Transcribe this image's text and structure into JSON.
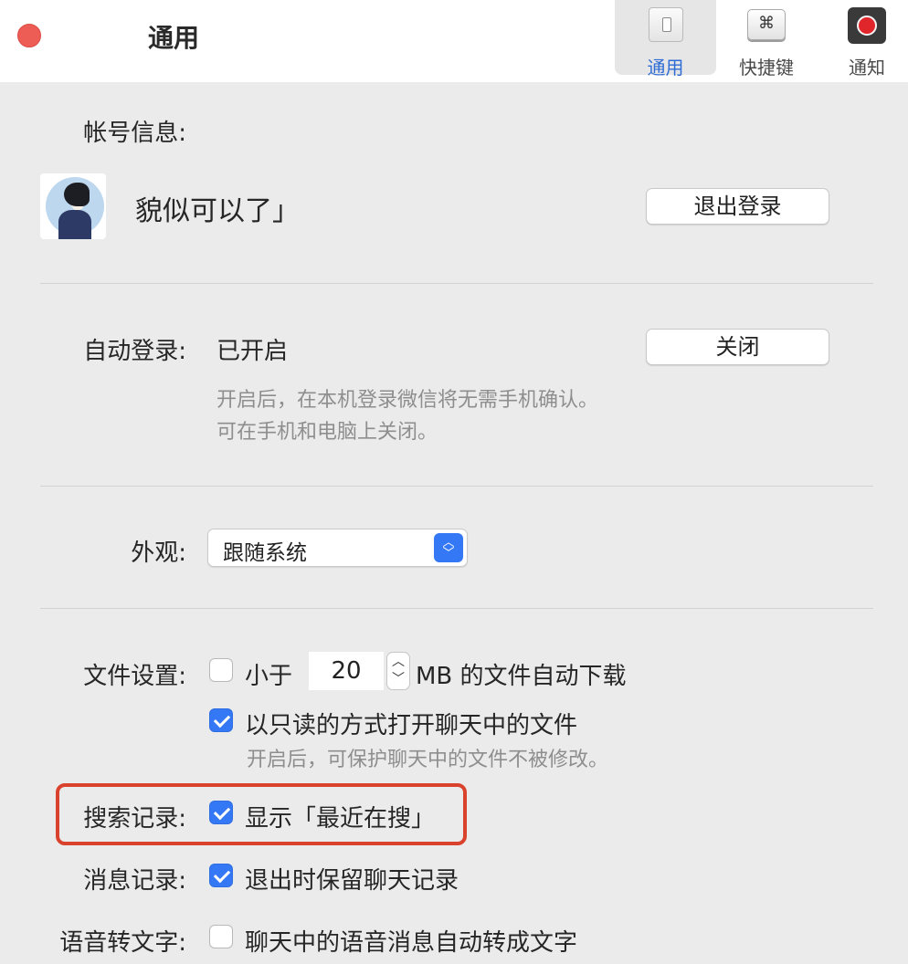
{
  "window": {
    "title": "通用",
    "tabs": [
      {
        "label": "通用",
        "icon": "switch-icon",
        "selected": true
      },
      {
        "label": "快捷键",
        "icon": "⌘"
      },
      {
        "label": "通知",
        "icon": "record-icon"
      }
    ]
  },
  "account": {
    "label": "帐号信息:",
    "nickname": "貌似可以了」",
    "logout_button": "退出登录"
  },
  "auto_login": {
    "label": "自动登录:",
    "status": "已开启",
    "button": "关闭",
    "hint_line1": "开启后，在本机登录微信将无需手机确认。",
    "hint_line2": "可在手机和电脑上关闭。"
  },
  "appearance": {
    "label": "外观:",
    "selected": "跟随系统"
  },
  "file_settings": {
    "label": "文件设置:",
    "auto_download": {
      "checked": false,
      "prefix": "小于",
      "size_value": "20",
      "suffix": "MB 的文件自动下载"
    },
    "read_only": {
      "checked": true,
      "text": "以只读的方式打开聊天中的文件",
      "hint": "开启后，可保护聊天中的文件不被修改。"
    }
  },
  "search_history": {
    "label": "搜索记录:",
    "checked": true,
    "text": "显示「最近在搜」"
  },
  "message_history": {
    "label": "消息记录:",
    "checked": true,
    "text": "退出时保留聊天记录"
  },
  "voice_to_text": {
    "label": "语音转文字:",
    "checked": false,
    "text": "聊天中的语音消息自动转成文字"
  },
  "colors": {
    "accent": "#3478f6",
    "close": "#ee5d55",
    "highlight": "#d9432e",
    "background": "#ecebeb"
  }
}
